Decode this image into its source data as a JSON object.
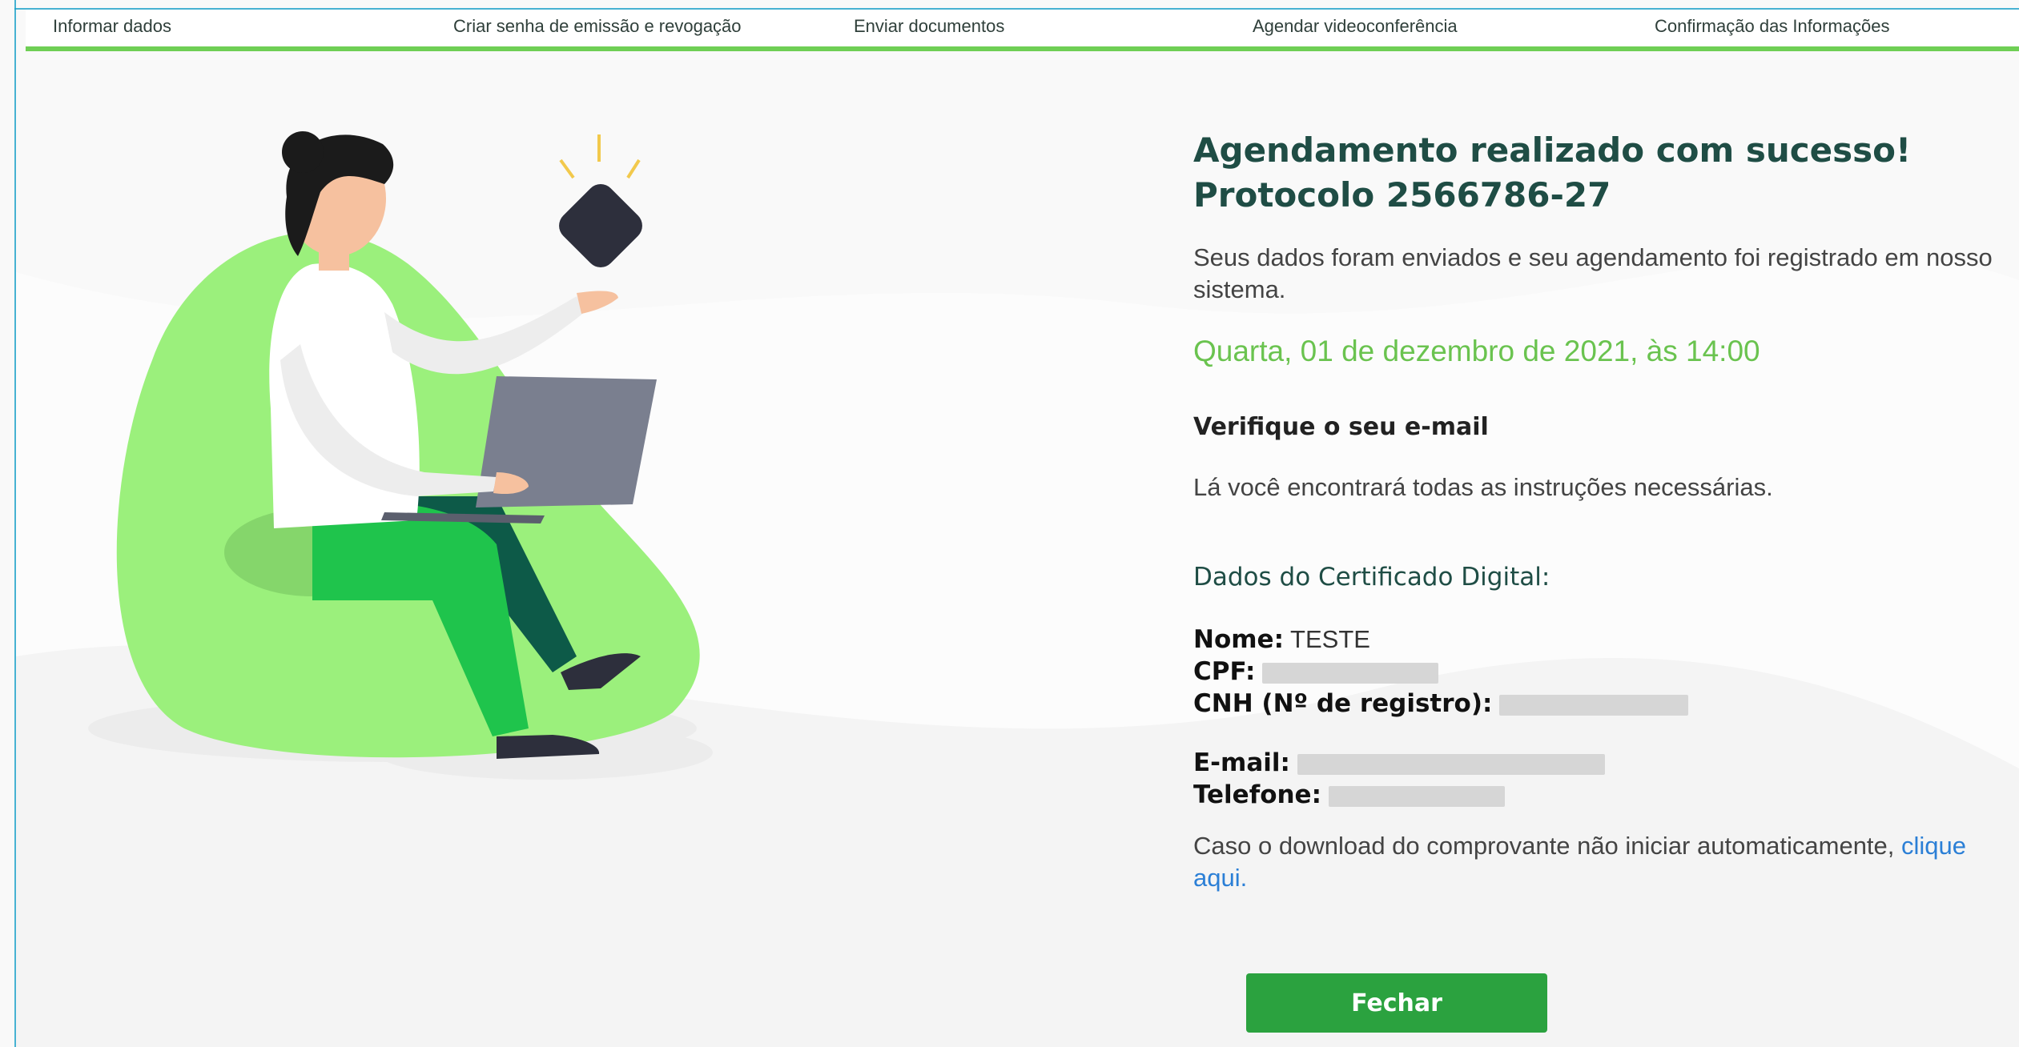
{
  "steps": [
    {
      "label": "Informar dados"
    },
    {
      "label": "Criar senha de emissão e revogação"
    },
    {
      "label": "Enviar documentos"
    },
    {
      "label": "Agendar videoconferência"
    },
    {
      "label": "Confirmação das Informações"
    }
  ],
  "confirmation": {
    "title_line1": "Agendamento realizado com sucesso!",
    "title_line2": "Protocolo 2566786-27",
    "description_line1": "Seus dados foram enviados e seu agendamento foi registrado em nosso",
    "description_line2": "sistema.",
    "appointment_date": "Quarta, 01 de dezembro de 2021, às 14:00",
    "check_email_title": "Verifique o seu e-mail",
    "check_email_text": "Lá você encontrará todas as instruções necessárias."
  },
  "certificate": {
    "section_title": "Dados do Certificado Digital:",
    "name_label": "Nome:",
    "name_value": "TESTE",
    "cpf_label": "CPF:",
    "cnh_label": "CNH (Nº de registro):",
    "email_label": "E-mail:",
    "phone_label": "Telefone:"
  },
  "download": {
    "text": "Caso o download do comprovante não iniciar automaticamente, ",
    "link": "clique aqui",
    "suffix": "."
  },
  "close_button": "Fechar",
  "colors": {
    "accent_green": "#6fcf55",
    "button_green": "#2ba23f",
    "title_green": "#1f4d45",
    "link_blue": "#2b7fd6"
  }
}
